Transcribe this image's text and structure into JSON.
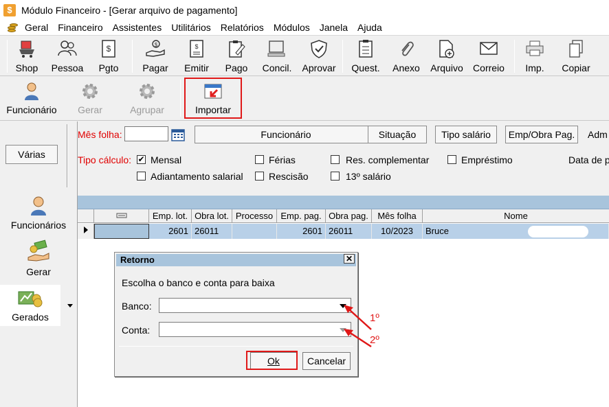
{
  "window": {
    "app_icon": "$",
    "title": "Módulo Financeiro - [Gerar arquivo de pagamento]"
  },
  "menu": [
    "Geral",
    "Financeiro",
    "Assistentes",
    "Utilitários",
    "Relatórios",
    "Módulos",
    "Janela",
    "Ajuda"
  ],
  "toolbar": {
    "shop": "Shop",
    "pessoa": "Pessoa",
    "pgto": "Pgto",
    "pagar": "Pagar",
    "emitir": "Emitir",
    "pago": "Pago",
    "concil": "Concil.",
    "aprovar": "Aprovar",
    "quest": "Quest.",
    "anexo": "Anexo",
    "arquivo": "Arquivo",
    "correio": "Correio",
    "imp": "Imp.",
    "copiar": "Copiar"
  },
  "subtoolbar": {
    "funcionario": "Funcionário",
    "gerar": "Gerar",
    "agrupar": "Agrupar",
    "importar": "Importar"
  },
  "left_nav": {
    "varias": "Várias",
    "funcionarios": "Funcionários",
    "gerar": "Gerar",
    "gerados": "Gerados"
  },
  "filters": {
    "mes_folha_label": "Mês folha:",
    "mes_folha_value": "",
    "btn_funcionario": "Funcionário",
    "btn_situacao": "Situação",
    "btn_tipo_salario": "Tipo salário",
    "btn_emp_obra": "Emp/Obra Pag.",
    "adm_label": "Adm",
    "tipo_calculo_label": "Tipo cálculo:",
    "options": {
      "mensal": "Mensal",
      "ferias": "Férias",
      "res_complementar": "Res. complementar",
      "emprestimo": "Empréstimo",
      "adiantamento": "Adiantamento salarial",
      "rescisao": "Rescisão",
      "decimo": "13º salário"
    },
    "mensal_checked": "✔",
    "data_label": "Data de p"
  },
  "grid": {
    "columns": [
      "Emp. lot.",
      "Obra lot.",
      "Processo",
      "Emp. pag.",
      "Obra pag.",
      "Mês folha",
      "Nome"
    ],
    "rows": [
      {
        "emp_lot": "2601",
        "obra_lot": "26011",
        "processo": "",
        "emp_pag": "2601",
        "obra_pag": "26011",
        "mes_folha": "10/2023",
        "nome": "Bruce"
      }
    ]
  },
  "dialog": {
    "title": "Retorno",
    "close": "✕",
    "prompt": "Escolha o banco e conta para baixa",
    "banco_label": "Banco:",
    "banco_value": "",
    "conta_label": "Conta:",
    "conta_value": "",
    "ok": "Ok",
    "cancelar": "Cancelar"
  },
  "annotations": {
    "first": "1º",
    "second": "2º",
    "color": "#e01818"
  }
}
